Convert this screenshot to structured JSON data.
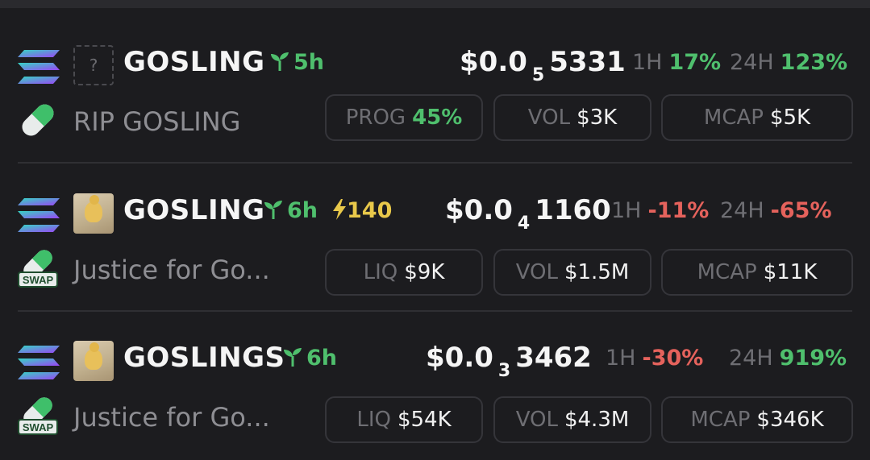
{
  "colors": {
    "background": "#1c1c1f",
    "positive": "#4fbf6d",
    "negative": "#e5625c",
    "muted": "#6e6e73",
    "boost": "#e8c84a"
  },
  "tokens": [
    {
      "name": "GOSLING",
      "age": "5h",
      "boost": "",
      "price_prefix": "$0.0",
      "price_zeros": "5",
      "price_digits": "5331",
      "h1_label": "1H",
      "h1_value": "17%",
      "h1_dir": "up",
      "h24_label": "24H",
      "h24_value": "123%",
      "h24_dir": "up",
      "description": "RIP GOSLING",
      "badge_icon": "pill-icon",
      "thumb_icon": "unknown-image-placeholder-icon",
      "thumb_text": "?",
      "stats": [
        {
          "label": "PROG",
          "value": "45%"
        },
        {
          "label": "VOL",
          "value": "$3K"
        },
        {
          "label": "MCAP",
          "value": "$5K"
        }
      ]
    },
    {
      "name": "GOSLING",
      "age": "6h",
      "boost": "140",
      "price_prefix": "$0.0",
      "price_zeros": "4",
      "price_digits": "1160",
      "h1_label": "1H",
      "h1_value": "-11%",
      "h1_dir": "down",
      "h24_label": "24H",
      "h24_value": "-65%",
      "h24_dir": "down",
      "description": "Justice for Go...",
      "badge_icon": "swap-icon",
      "badge_text": "SWAP",
      "thumb_icon": "gosling-image",
      "stats": [
        {
          "label": "LIQ",
          "value": "$9K"
        },
        {
          "label": "VOL",
          "value": "$1.5M"
        },
        {
          "label": "MCAP",
          "value": "$11K"
        }
      ]
    },
    {
      "name": "GOSLINGS",
      "age": "6h",
      "boost": "",
      "price_prefix": "$0.0",
      "price_zeros": "3",
      "price_digits": "3462",
      "h1_label": "1H",
      "h1_value": "-30%",
      "h1_dir": "down",
      "h24_label": "24H",
      "h24_value": "919%",
      "h24_dir": "up",
      "description": "Justice for Go...",
      "badge_icon": "swap-icon",
      "badge_text": "SWAP",
      "thumb_icon": "gosling-image",
      "stats": [
        {
          "label": "LIQ",
          "value": "$54K"
        },
        {
          "label": "VOL",
          "value": "$4.3M"
        },
        {
          "label": "MCAP",
          "value": "$346K"
        }
      ]
    }
  ]
}
